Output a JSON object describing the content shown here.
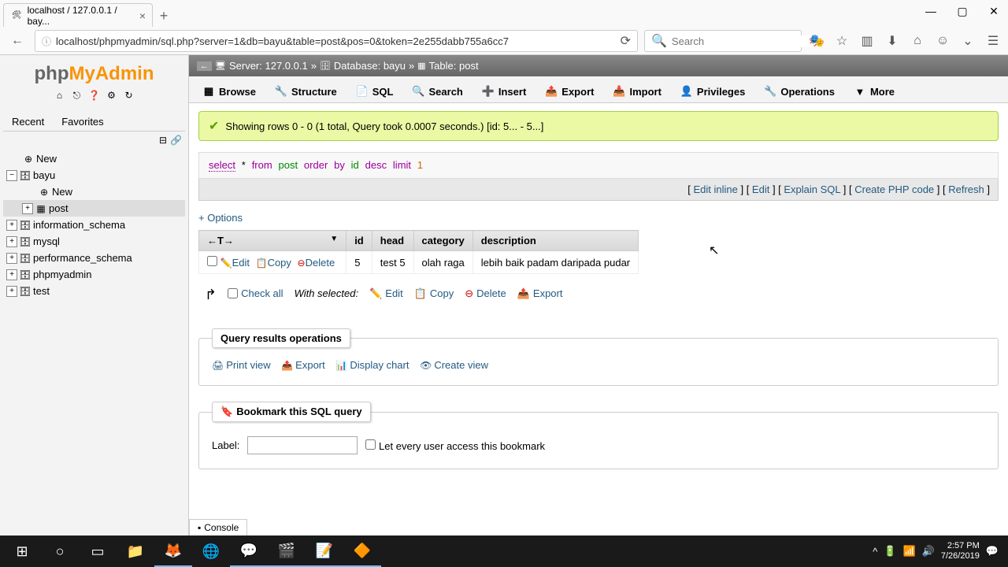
{
  "browser": {
    "tab_title": "localhost / 127.0.0.1 / bay...",
    "url": "localhost/phpmyadmin/sql.php?server=1&db=bayu&table=post&pos=0&token=2e255dabb755a6cc7",
    "search_placeholder": "Search"
  },
  "logo": {
    "php": "php",
    "my": "My",
    "admin": "Admin"
  },
  "side_tabs": {
    "recent": "Recent",
    "favorites": "Favorites"
  },
  "tree": {
    "new": "New",
    "bayu": "bayu",
    "bayu_new": "New",
    "post": "post",
    "information_schema": "information_schema",
    "mysql": "mysql",
    "performance_schema": "performance_schema",
    "phpmyadmin": "phpmyadmin",
    "test": "test"
  },
  "breadcrumb": {
    "server_label": "Server:",
    "server_val": "127.0.0.1",
    "db_label": "Database:",
    "db_val": "bayu",
    "table_label": "Table:",
    "table_val": "post"
  },
  "top_tabs": {
    "browse": "Browse",
    "structure": "Structure",
    "sql": "SQL",
    "search": "Search",
    "insert": "Insert",
    "export": "Export",
    "import": "Import",
    "privileges": "Privileges",
    "operations": "Operations",
    "more": "More"
  },
  "success_msg": "Showing rows 0 - 0 (1 total, Query took 0.0007 seconds.) [id: 5... - 5...]",
  "sql": {
    "p1": "select",
    "p2": "*",
    "p3": "from",
    "p4": "post",
    "p5": "order",
    "p6": "by",
    "p7": "id",
    "p8": "desc",
    "p9": "limit",
    "p10": "1"
  },
  "actions": {
    "edit_inline": "Edit inline",
    "edit": "Edit",
    "explain": "Explain SQL",
    "php": "Create PHP code",
    "refresh": "Refresh"
  },
  "options": "+ Options",
  "table": {
    "hdr_arrow": "←T→",
    "hdr_id": "id",
    "hdr_head": "head",
    "hdr_category": "category",
    "hdr_description": "description",
    "row_edit": "Edit",
    "row_copy": "Copy",
    "row_delete": "Delete",
    "row_id": "5",
    "row_head": "test 5",
    "row_category": "olah raga",
    "row_desc": "lebih baik padam daripada pudar"
  },
  "bulk": {
    "check_all": "Check all",
    "with": "With selected:",
    "edit": "Edit",
    "copy": "Copy",
    "delete": "Delete",
    "export": "Export"
  },
  "ops": {
    "legend": "Query results operations",
    "print": "Print view",
    "export": "Export",
    "chart": "Display chart",
    "view": "Create view"
  },
  "bookmark": {
    "legend": "Bookmark this SQL query",
    "label": "Label:",
    "public": "Let every user access this bookmark"
  },
  "console": "Console",
  "clock": {
    "time": "2:57 PM",
    "date": "7/26/2019"
  }
}
